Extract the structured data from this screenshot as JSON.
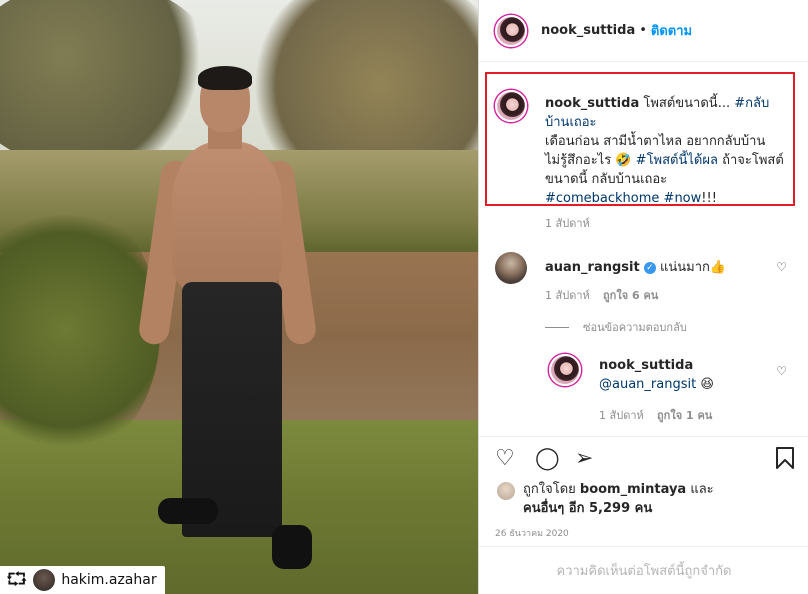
{
  "repost": {
    "username": "hakim.azahar",
    "icon": "repost-icon"
  },
  "header": {
    "username": "nook_suttida",
    "separator": "•",
    "follow_label": "ติดตาม"
  },
  "caption": {
    "username": "nook_suttida",
    "text_1": "โพสต์ขนาดนี้... ",
    "tag_1": "#กลับบ้านเถอะ",
    "text_2": "เดือนก่อน สามีน้ำตาไหล อยากกลับบ้านไม่รู้สึกอะไร 🤣 ",
    "tag_2": "#โพสต์นี้ได้ผล",
    "text_3": " ถ้าจะโพสต์ขนาดนี้ กลับบ้านเถอะ",
    "tag_3": "#comebackhome",
    "tag_4": "#now",
    "text_4": "!!!",
    "time": "1 สัปดาห์"
  },
  "comments": [
    {
      "username": "auan_rangsit",
      "verified": true,
      "text": " แน่นมาก👍",
      "time": "1 สัปดาห์",
      "likes": "ถูกใจ 6 คน"
    }
  ],
  "view_replies_label": "ซ่อนข้อความตอบกลับ",
  "reply": {
    "username": "nook_suttida",
    "mention": "@auan_rangsit",
    "emoji": " 😆",
    "time": "1 สัปดาห์",
    "likes": "ถูกใจ 1 คน"
  },
  "actions": {
    "like": "like-icon",
    "comment": "comment-icon",
    "share": "share-icon",
    "save": "bookmark-icon"
  },
  "likes_summary": {
    "prefix": "ถูกใจโดย ",
    "user": "boom_mintaya",
    "middle": " และ",
    "others": "คนอื่นๆ อีก 5,299 คน"
  },
  "post_date": "26 ธันวาคม 2020",
  "comments_limited": "ความคิดเห็นต่อโพสต์นี้ถูกจำกัด"
}
